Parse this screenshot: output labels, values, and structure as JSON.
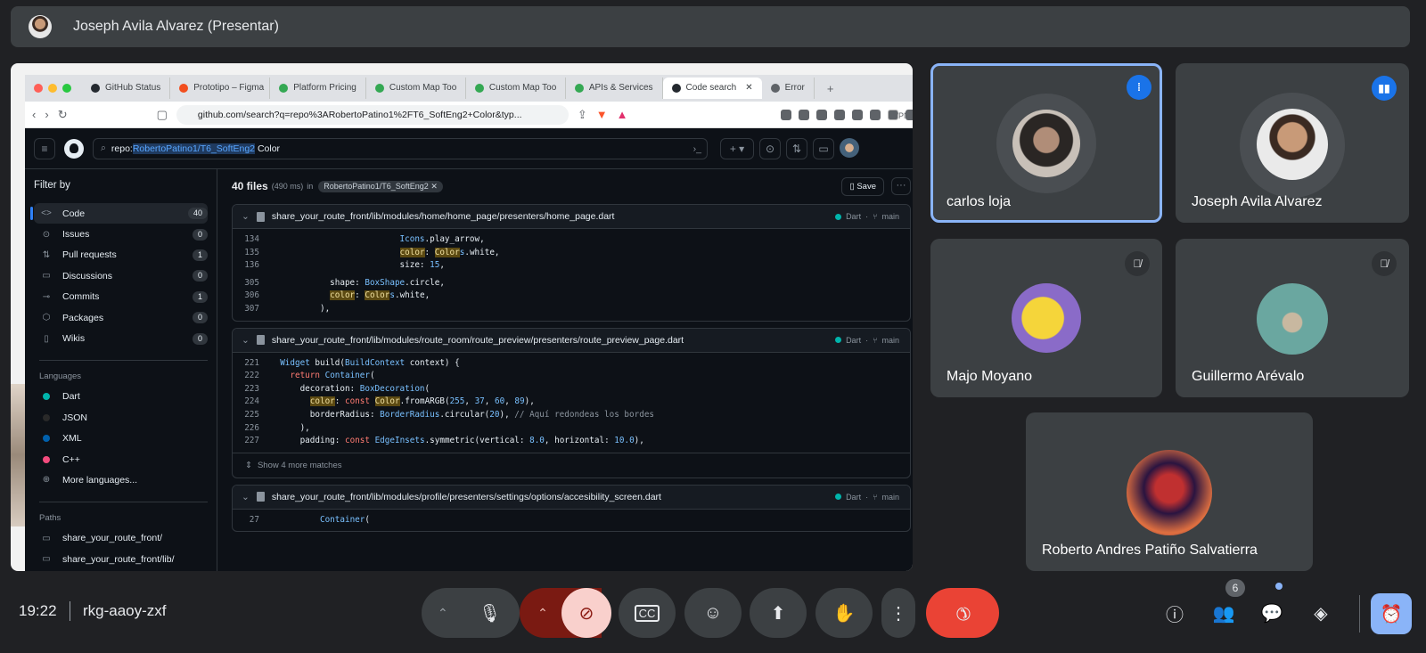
{
  "meeting": {
    "presenter_label": "Joseph Avila Alvarez (Presentar)",
    "time": "19:22",
    "code": "rkg-aaoy-zxf",
    "participants_count": "6"
  },
  "browser": {
    "tabs": [
      {
        "label": "GitHub Status",
        "color": "#24292f"
      },
      {
        "label": "Prototipo – Figma",
        "color": "#f24e1e"
      },
      {
        "label": "Platform Pricing",
        "color": "#34a853"
      },
      {
        "label": "Custom Map Too",
        "color": "#34a853"
      },
      {
        "label": "Custom Map Too",
        "color": "#34a853"
      },
      {
        "label": "APIs & Services",
        "color": "#34a853"
      },
      {
        "label": "Code search",
        "color": "#24292f"
      },
      {
        "label": "Error",
        "color": "#5f6368"
      }
    ],
    "url": "github.com/search?q=repo%3ARobertoPatino1%2FT6_SoftEng2+Color&typ...",
    "vpn": "VPN"
  },
  "github": {
    "search_prefix": "repo:",
    "search_repo": "RobertoPatino1/T6_SoftEng2",
    "search_term": "Color",
    "filter_title": "Filter by",
    "filters": [
      {
        "label": "Code",
        "count": "40",
        "icon": "<>"
      },
      {
        "label": "Issues",
        "count": "0",
        "icon": "⊙"
      },
      {
        "label": "Pull requests",
        "count": "1",
        "icon": "⇅"
      },
      {
        "label": "Discussions",
        "count": "0",
        "icon": "▭"
      },
      {
        "label": "Commits",
        "count": "1",
        "icon": "⊸"
      },
      {
        "label": "Packages",
        "count": "0",
        "icon": "⬡"
      },
      {
        "label": "Wikis",
        "count": "0",
        "icon": "▯"
      }
    ],
    "languages_title": "Languages",
    "languages": [
      {
        "label": "Dart",
        "color": "#00b4ab"
      },
      {
        "label": "JSON",
        "color": "#292929"
      },
      {
        "label": "XML",
        "color": "#0060ac"
      },
      {
        "label": "C++",
        "color": "#f34b7d"
      }
    ],
    "more_languages": "More languages...",
    "paths_title": "Paths",
    "paths": [
      "share_your_route_front/",
      "share_your_route_front/lib/"
    ],
    "results_count": "40 files",
    "results_time": "(490 ms)",
    "results_in": "in",
    "results_repo": "RobertoPatino1/T6_SoftEng2",
    "save_label": "Save",
    "lang_tag": "Dart",
    "branch_tag": "main",
    "results": [
      {
        "path": "share_your_route_front/lib/modules/home/home_page/presenters/home_page.dart",
        "lines": [
          {
            "n": "134",
            "code": "                          Icons.play_arrow,"
          },
          {
            "n": "135",
            "code": "                          color: Colors.white,"
          },
          {
            "n": "136",
            "code": "                          size: 15,"
          },
          {
            "n": "305",
            "code": "            shape: BoxShape.circle,"
          },
          {
            "n": "306",
            "code": "            color: Colors.white,"
          },
          {
            "n": "307",
            "code": "          ),"
          }
        ]
      },
      {
        "path": "share_your_route_front/lib/modules/route_room/route_preview/presenters/route_preview_page.dart",
        "lines": [
          {
            "n": "221",
            "code": "  Widget build(BuildContext context) {"
          },
          {
            "n": "222",
            "code": "    return Container("
          },
          {
            "n": "223",
            "code": "      decoration: BoxDecoration("
          },
          {
            "n": "224",
            "code": "        color: const Color.fromARGB(255, 37, 60, 89),"
          },
          {
            "n": "225",
            "code": "        borderRadius: BorderRadius.circular(20), // Aquí redondeas los bordes"
          },
          {
            "n": "226",
            "code": "      ),"
          },
          {
            "n": "227",
            "code": "      padding: const EdgeInsets.symmetric(vertical: 8.0, horizontal: 10.0),"
          }
        ],
        "show_more": "Show 4 more matches"
      },
      {
        "path": "share_your_route_front/lib/modules/profile/presenters/settings/options/accesibility_screen.dart",
        "lines": [
          {
            "n": "27",
            "code": "          Container("
          }
        ]
      }
    ]
  },
  "participants": [
    {
      "name": "carlos loja",
      "state": "speaking"
    },
    {
      "name": "Joseph Avila Alvarez",
      "state": "talking"
    },
    {
      "name": "Majo Moyano",
      "state": "muted"
    },
    {
      "name": "Guillermo Arévalo",
      "state": "muted"
    },
    {
      "name": "Roberto Andres Patiño Salvatierra",
      "state": "none"
    }
  ],
  "colors": {
    "accent": "#8ab4f8",
    "end_call": "#ea4335",
    "tile_bg": "#3c4043"
  }
}
